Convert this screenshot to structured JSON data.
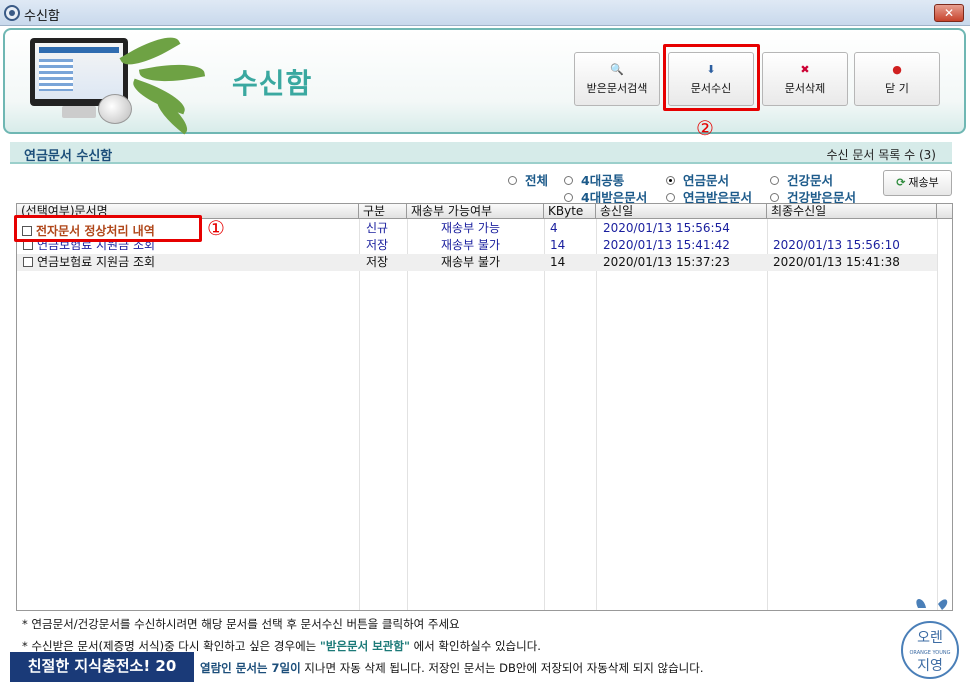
{
  "window": {
    "title": "수신함",
    "close_glyph": "✕"
  },
  "header": {
    "title": "수신함"
  },
  "toolbar": [
    {
      "name": "search-received-button",
      "icon": "magnifier-doc-icon",
      "icon_glyph": "🔍",
      "label": "받은문서검색"
    },
    {
      "name": "receive-documents-button",
      "icon": "download-doc-icon",
      "icon_glyph": "⬇",
      "label": "문서수신"
    },
    {
      "name": "delete-documents-button",
      "icon": "delete-folder-icon",
      "icon_glyph": "✖",
      "label": "문서삭제"
    },
    {
      "name": "close-button",
      "icon": "stop-icon",
      "icon_glyph": "●",
      "label": "닫 기"
    }
  ],
  "callouts": {
    "one": "①",
    "two": "②"
  },
  "section": {
    "left": "연금문서 수신함",
    "right": "수신 문서 목록 수 (3)"
  },
  "filters": [
    {
      "label": "전체",
      "selected": false
    },
    {
      "label": "4대공통",
      "selected": false
    },
    {
      "label": "연금문서",
      "selected": true
    },
    {
      "label": "건강문서",
      "selected": false
    },
    {
      "label": "4대받은문서",
      "selected": false
    },
    {
      "label": "연금받은문서",
      "selected": false
    },
    {
      "label": "건강받은문서",
      "selected": false
    }
  ],
  "resend": {
    "label": "재송부",
    "icon": "refresh-icon"
  },
  "table": {
    "columns": [
      "(선택여부)문서명",
      "구분",
      "재송부 가능여부",
      "KByte",
      "송신일",
      "최종수신일"
    ],
    "rows": [
      {
        "name": "전자문서 정상처리 내역",
        "type": "신규",
        "resend": "재송부 가능",
        "kbyte": "4",
        "sent": "2020/01/13 15:56:54",
        "last": ""
      },
      {
        "name": "연금보험료 지원금 조회",
        "type": "저장",
        "resend": "재송부 불가",
        "kbyte": "14",
        "sent": "2020/01/13 15:41:42",
        "last": "2020/01/13 15:56:10"
      },
      {
        "name": "연금보험료 지원금 조회",
        "type": "저장",
        "resend": "재송부 불가",
        "kbyte": "14",
        "sent": "2020/01/13 15:37:23",
        "last": "2020/01/13 15:41:38"
      }
    ]
  },
  "notes": {
    "n1": "* 연금문서/건강문서를 수신하시려면 해당 문서를 선택 후 문서수신 버튼을 클릭하여 주세요",
    "n2a": "* 수신받은 문서(제증명 서식)중 다시 확인하고 싶은 경우에는 ",
    "n2b": "\"받은문서 보관함\"",
    "n2c": " 에서 확인하실수 있습니다.",
    "n3a": "열람인 문서는 7일이",
    "n3b": " 지나면 자동 삭제 됩니다. 저장인 문서는 DB안에 저장되어 자동삭제 되지 않습니다."
  },
  "banner": "친절한 지식충전소! 20",
  "logo": {
    "brand_top": "오렌",
    "brand_bottom": "지영",
    "text": "ORANGE YOUNG"
  },
  "colors": {
    "accent": "#3aa8a0",
    "highlight": "#e60000",
    "blue_text": "#1a1f9e"
  }
}
